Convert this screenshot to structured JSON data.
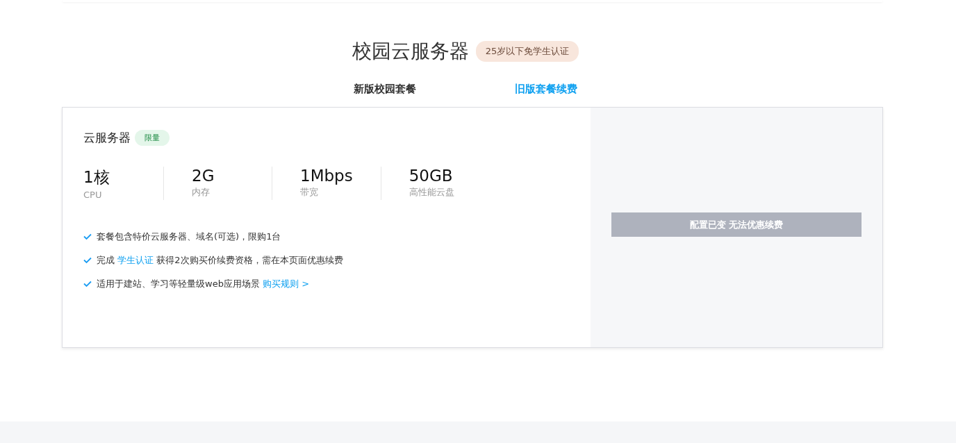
{
  "header": {
    "title": "校园云服务器",
    "badge": "25岁以下免学生认证"
  },
  "tabs": [
    {
      "label": "新版校园套餐",
      "selected": false
    },
    {
      "label": "旧版套餐续费",
      "selected": true
    }
  ],
  "plan": {
    "name": "云服务器",
    "tag": "限量",
    "specs": [
      {
        "value": "1核",
        "label": "CPU"
      },
      {
        "value": "2G",
        "label": "内存"
      },
      {
        "value": "1Mbps",
        "label": "带宽"
      },
      {
        "value": "50GB",
        "label": "高性能云盘"
      }
    ],
    "features": [
      [
        {
          "kind": "text",
          "text": "套餐包含特价云服务器、域名(可选)，限购1台"
        }
      ],
      [
        {
          "kind": "text",
          "text": "完成 "
        },
        {
          "kind": "link",
          "text": "学生认证"
        },
        {
          "kind": "text",
          "text": " 获得2次购买价续费资格，需在本页面优惠续费"
        }
      ],
      [
        {
          "kind": "text",
          "text": "适用于建站、学习等轻量级web应用场景 "
        },
        {
          "kind": "link",
          "text": "购买规则 >"
        }
      ]
    ]
  },
  "action": {
    "label": "配置已变 无法优惠续费",
    "disabled": true
  }
}
